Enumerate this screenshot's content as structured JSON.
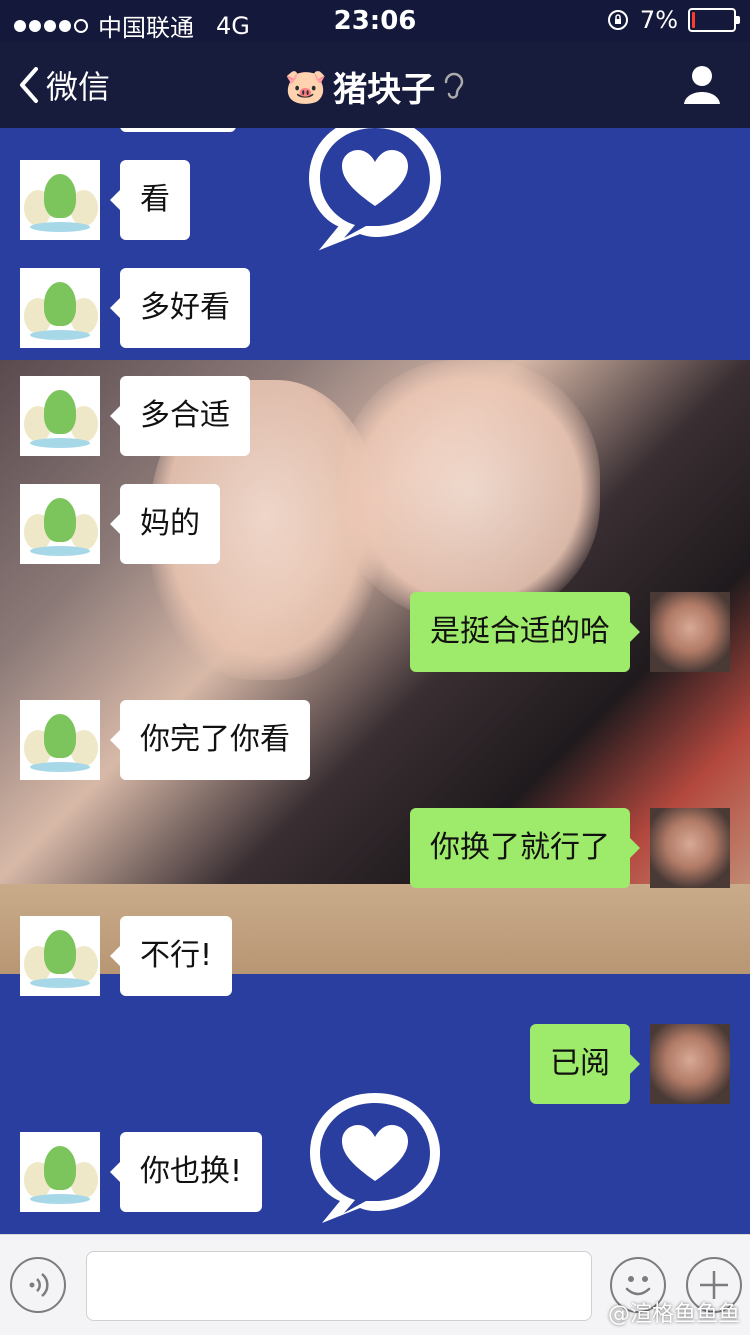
{
  "status": {
    "carrier": "中国联通",
    "network": "4G",
    "time": "23:06",
    "battery_percent": "7%",
    "battery_level": 0.07
  },
  "nav": {
    "back_label": "微信",
    "title": "猪块子",
    "title_emoji": "🐷"
  },
  "messages": [
    {
      "side": "left",
      "text": "看"
    },
    {
      "side": "left",
      "text": "多好看"
    },
    {
      "side": "left",
      "text": "多合适"
    },
    {
      "side": "left",
      "text": "妈的"
    },
    {
      "side": "right",
      "text": "是挺合适的哈"
    },
    {
      "side": "left",
      "text": "你完了你看"
    },
    {
      "side": "right",
      "text": "你换了就行了"
    },
    {
      "side": "left",
      "text": "不行!"
    },
    {
      "side": "right",
      "text": "已阅"
    },
    {
      "side": "left",
      "text": "你也换!"
    }
  ],
  "watermark": "@渲格鱼鱼鱼",
  "colors": {
    "chat_background": "#2a3ea0",
    "nav_background": "#171b3c",
    "sent_bubble": "#9eea6a",
    "received_bubble": "#ffffff"
  }
}
